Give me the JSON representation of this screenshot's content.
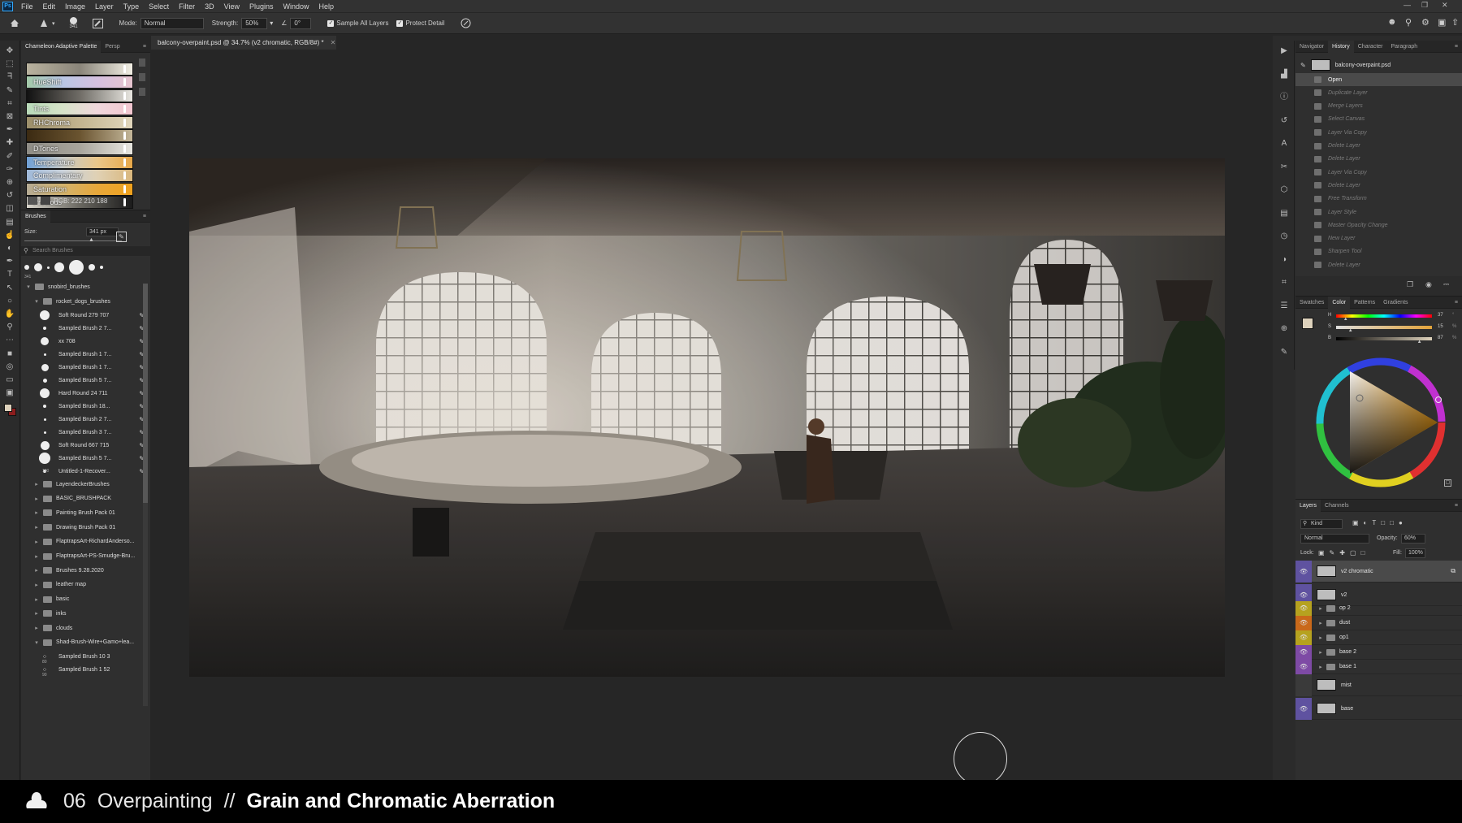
{
  "menu": {
    "app_logo": "Ps",
    "items": [
      "File",
      "Edit",
      "Image",
      "Layer",
      "Type",
      "Select",
      "Filter",
      "3D",
      "View",
      "Plugins",
      "Window",
      "Help"
    ]
  },
  "options": {
    "brush_size": "341",
    "mode_label": "Mode:",
    "mode_value": "Normal",
    "strength_label": "Strength:",
    "strength_value": "50%",
    "angle_value": "0°",
    "sample_all_layers": "Sample All Layers",
    "protect_detail": "Protect Detail"
  },
  "document": {
    "tab_title": "balcony-overpaint.psd @ 34.7% (v2 chromatic, RGB/8#) *"
  },
  "chameleon": {
    "tabs": [
      "Chameleon Adaptive Palette",
      "Persp"
    ],
    "rows": [
      {
        "label": "",
        "gradient": "linear-gradient(90deg,#b9b29e,#8a857a,#f2efe4)"
      },
      {
        "label": "HueShift",
        "gradient": "linear-gradient(90deg,#a3c9a8,#b9c7e4,#d5c0e0,#e7c5cf)"
      },
      {
        "label": "",
        "gradient": "linear-gradient(90deg,#111,#6f6c66,#e8e6e0)"
      },
      {
        "label": "Tints",
        "gradient": "linear-gradient(90deg,#b8dab9,#d6e3c8,#f0d7dc,#f2c6d0)"
      },
      {
        "label": "RHChroma",
        "gradient": "linear-gradient(90deg,#9b8e6a,#c3b48f,#e2d7bd)"
      },
      {
        "label": "",
        "gradient": "linear-gradient(90deg,#3b2a12,#6a5430,#c4b79a)"
      },
      {
        "label": "DTones",
        "gradient": "linear-gradient(90deg,#8f8d86,#a8a59c,#e8e6e0)"
      },
      {
        "label": "Temperature",
        "gradient": "linear-gradient(90deg,#6fa0d6,#c5c8c6,#e9c68a,#e8a84a)"
      },
      {
        "label": "Complimentary",
        "gradient": "linear-gradient(90deg,#9fb9d9,#c7cfd8,#e0d1b4,#d9b77d)"
      },
      {
        "label": "Saturation",
        "gradient": "linear-gradient(90deg,#b5ab95,#d2b36e,#e7a73a,#f0a21d)"
      },
      {
        "label": "Previous",
        "gradient": "linear-gradient(90deg,#d8d5cc,#6a6861,#1b1b1b)"
      }
    ],
    "rgb_readout": "RGB: 222 210 188",
    "swatch_color": "#ded2bc"
  },
  "brushes": {
    "title": "Brushes",
    "size_label": "Size:",
    "size_value": "341 px",
    "search_placeholder": "Search Brushes",
    "recent_size": "341",
    "root_group": "snobird_brushes",
    "open_group": "rocket_dogs_brushes",
    "items": [
      {
        "name": "Soft Round 279 707",
        "size": 12
      },
      {
        "name": "Sampled Brush 2 7...",
        "size": 4
      },
      {
        "name": "xx 708",
        "size": 10
      },
      {
        "name": "Sampled Brush 1 7...",
        "size": 3
      },
      {
        "name": "Sampled Brush 1 7...",
        "size": 9
      },
      {
        "name": "Sampled Brush 5 7...",
        "size": 5
      },
      {
        "name": "Hard Round 24 711",
        "size": 12
      },
      {
        "name": "Sampled Brush 18...",
        "size": 4
      },
      {
        "name": "Sampled Brush 2 7...",
        "size": 3
      },
      {
        "name": "Sampled Brush 3 7...",
        "size": 3
      },
      {
        "name": "Soft Round 667 715",
        "size": 11
      },
      {
        "name": "Sampled Brush 5 7...",
        "size": 14
      },
      {
        "name": "Untitled-1-Recover...",
        "size": 4
      }
    ],
    "last_item_size": "100",
    "groups": [
      "LayendeckerBrushes",
      "BASIC_BRUSHPACK",
      "Painting Brush Pack 01",
      "Drawing Brush Pack 01",
      "FlaptrapsArt-RichardAnderso...",
      "FlaptrapsArt-PS-Smudge-Bru...",
      "Brushes 9.28.2020",
      "leather map",
      "basic",
      "inks",
      "clouds"
    ],
    "expanded_group": "Shad-Brush-Wire+Gamo+lea...",
    "sub_items": [
      "Sampled Brush 10 3",
      "Sampled Brush 1 52"
    ],
    "sub_sizes": [
      "80",
      "90"
    ]
  },
  "history": {
    "tabs": [
      "Navigator",
      "History",
      "Character",
      "Paragraph"
    ],
    "snapshot": "balcony-overpaint.psd",
    "states": [
      "Open",
      "Duplicate Layer",
      "Merge Layers",
      "Select Canvas",
      "Layer Via Copy",
      "Delete Layer",
      "Delete Layer",
      "Layer Via Copy",
      "Delete Layer",
      "Free Transform",
      "Layer Style",
      "Master Opacity Change",
      "New Layer",
      "Sharpen Tool",
      "Delete Layer"
    ]
  },
  "color": {
    "tabs": [
      "Swatches",
      "Color",
      "Patterns",
      "Gradients"
    ],
    "sliders": [
      {
        "label": "H",
        "value": "37",
        "unit": "°",
        "fraction": 0.1
      },
      {
        "label": "S",
        "value": "15",
        "unit": "%",
        "fraction": 0.15
      },
      {
        "label": "B",
        "value": "87",
        "unit": "%",
        "fraction": 0.87
      }
    ],
    "foreground": "#ded2bc",
    "background": "#8b1d1d"
  },
  "layers": {
    "tabs": [
      "Layers",
      "Channels"
    ],
    "filter_kind": "Kind",
    "blend_mode": "Normal",
    "opacity_label": "Opacity:",
    "opacity_value": "60%",
    "lock_label": "Lock:",
    "fill_label": "Fill:",
    "fill_value": "100%",
    "items": [
      {
        "name": "v2 chromatic",
        "type": "layer",
        "color": "#5f52a0",
        "selected": true,
        "visible": true
      },
      {
        "name": "v2",
        "type": "layer",
        "color": "#5f52a0",
        "selected": false,
        "visible": true
      },
      {
        "name": "op 2",
        "type": "group",
        "color": "#b6a21f",
        "selected": false,
        "visible": true
      },
      {
        "name": "dust",
        "type": "group",
        "color": "#c9691a",
        "selected": false,
        "visible": true
      },
      {
        "name": "op1",
        "type": "group",
        "color": "#b6a21f",
        "selected": false,
        "visible": true
      },
      {
        "name": "base 2",
        "type": "group",
        "color": "#7e4aa5",
        "selected": false,
        "visible": true
      },
      {
        "name": "base 1",
        "type": "group",
        "color": "#7e4aa5",
        "selected": false,
        "visible": true
      },
      {
        "name": "mist",
        "type": "layer",
        "color": "#3a3a3a",
        "selected": false,
        "visible": false
      },
      {
        "name": "base",
        "type": "layer",
        "color": "#5f52a0",
        "selected": false,
        "visible": true
      }
    ]
  },
  "banner": {
    "number": "06",
    "section": "Overpainting",
    "separator": "//",
    "title": "Grain and Chromatic Aberration"
  }
}
